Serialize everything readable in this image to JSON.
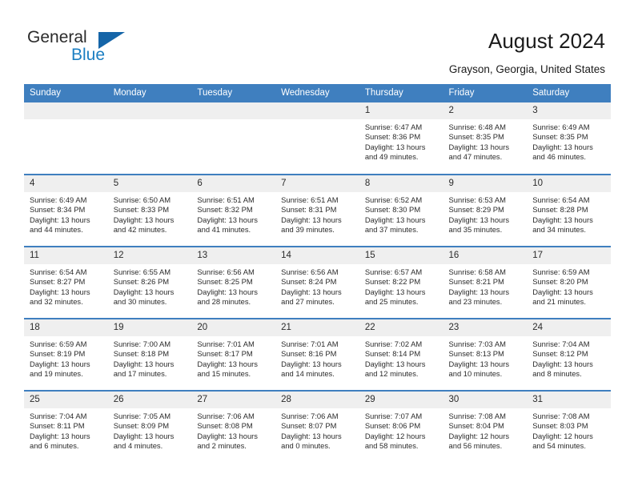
{
  "brand": {
    "name_top": "General",
    "name_bottom": "Blue",
    "triangle_color": "#1565a8",
    "blue_text_color": "#1b7ec2"
  },
  "header": {
    "title": "August 2024",
    "subtitle": "Grayson, Georgia, United States",
    "accent_color": "#3f7fbf",
    "daynum_band_color": "#efefef"
  },
  "calendar": {
    "weekday_headers": [
      "Sunday",
      "Monday",
      "Tuesday",
      "Wednesday",
      "Thursday",
      "Friday",
      "Saturday"
    ],
    "labels": {
      "sunrise": "Sunrise:",
      "sunset": "Sunset:",
      "daylight": "Daylight:"
    },
    "weeks": [
      [
        {
          "day": "",
          "empty": true
        },
        {
          "day": "",
          "empty": true
        },
        {
          "day": "",
          "empty": true
        },
        {
          "day": "",
          "empty": true
        },
        {
          "day": "1",
          "sunrise": "Sunrise: 6:47 AM",
          "sunset": "Sunset: 8:36 PM",
          "daylight": "Daylight: 13 hours and 49 minutes."
        },
        {
          "day": "2",
          "sunrise": "Sunrise: 6:48 AM",
          "sunset": "Sunset: 8:35 PM",
          "daylight": "Daylight: 13 hours and 47 minutes."
        },
        {
          "day": "3",
          "sunrise": "Sunrise: 6:49 AM",
          "sunset": "Sunset: 8:35 PM",
          "daylight": "Daylight: 13 hours and 46 minutes."
        }
      ],
      [
        {
          "day": "4",
          "sunrise": "Sunrise: 6:49 AM",
          "sunset": "Sunset: 8:34 PM",
          "daylight": "Daylight: 13 hours and 44 minutes."
        },
        {
          "day": "5",
          "sunrise": "Sunrise: 6:50 AM",
          "sunset": "Sunset: 8:33 PM",
          "daylight": "Daylight: 13 hours and 42 minutes."
        },
        {
          "day": "6",
          "sunrise": "Sunrise: 6:51 AM",
          "sunset": "Sunset: 8:32 PM",
          "daylight": "Daylight: 13 hours and 41 minutes."
        },
        {
          "day": "7",
          "sunrise": "Sunrise: 6:51 AM",
          "sunset": "Sunset: 8:31 PM",
          "daylight": "Daylight: 13 hours and 39 minutes."
        },
        {
          "day": "8",
          "sunrise": "Sunrise: 6:52 AM",
          "sunset": "Sunset: 8:30 PM",
          "daylight": "Daylight: 13 hours and 37 minutes."
        },
        {
          "day": "9",
          "sunrise": "Sunrise: 6:53 AM",
          "sunset": "Sunset: 8:29 PM",
          "daylight": "Daylight: 13 hours and 35 minutes."
        },
        {
          "day": "10",
          "sunrise": "Sunrise: 6:54 AM",
          "sunset": "Sunset: 8:28 PM",
          "daylight": "Daylight: 13 hours and 34 minutes."
        }
      ],
      [
        {
          "day": "11",
          "sunrise": "Sunrise: 6:54 AM",
          "sunset": "Sunset: 8:27 PM",
          "daylight": "Daylight: 13 hours and 32 minutes."
        },
        {
          "day": "12",
          "sunrise": "Sunrise: 6:55 AM",
          "sunset": "Sunset: 8:26 PM",
          "daylight": "Daylight: 13 hours and 30 minutes."
        },
        {
          "day": "13",
          "sunrise": "Sunrise: 6:56 AM",
          "sunset": "Sunset: 8:25 PM",
          "daylight": "Daylight: 13 hours and 28 minutes."
        },
        {
          "day": "14",
          "sunrise": "Sunrise: 6:56 AM",
          "sunset": "Sunset: 8:24 PM",
          "daylight": "Daylight: 13 hours and 27 minutes."
        },
        {
          "day": "15",
          "sunrise": "Sunrise: 6:57 AM",
          "sunset": "Sunset: 8:22 PM",
          "daylight": "Daylight: 13 hours and 25 minutes."
        },
        {
          "day": "16",
          "sunrise": "Sunrise: 6:58 AM",
          "sunset": "Sunset: 8:21 PM",
          "daylight": "Daylight: 13 hours and 23 minutes."
        },
        {
          "day": "17",
          "sunrise": "Sunrise: 6:59 AM",
          "sunset": "Sunset: 8:20 PM",
          "daylight": "Daylight: 13 hours and 21 minutes."
        }
      ],
      [
        {
          "day": "18",
          "sunrise": "Sunrise: 6:59 AM",
          "sunset": "Sunset: 8:19 PM",
          "daylight": "Daylight: 13 hours and 19 minutes."
        },
        {
          "day": "19",
          "sunrise": "Sunrise: 7:00 AM",
          "sunset": "Sunset: 8:18 PM",
          "daylight": "Daylight: 13 hours and 17 minutes."
        },
        {
          "day": "20",
          "sunrise": "Sunrise: 7:01 AM",
          "sunset": "Sunset: 8:17 PM",
          "daylight": "Daylight: 13 hours and 15 minutes."
        },
        {
          "day": "21",
          "sunrise": "Sunrise: 7:01 AM",
          "sunset": "Sunset: 8:16 PM",
          "daylight": "Daylight: 13 hours and 14 minutes."
        },
        {
          "day": "22",
          "sunrise": "Sunrise: 7:02 AM",
          "sunset": "Sunset: 8:14 PM",
          "daylight": "Daylight: 13 hours and 12 minutes."
        },
        {
          "day": "23",
          "sunrise": "Sunrise: 7:03 AM",
          "sunset": "Sunset: 8:13 PM",
          "daylight": "Daylight: 13 hours and 10 minutes."
        },
        {
          "day": "24",
          "sunrise": "Sunrise: 7:04 AM",
          "sunset": "Sunset: 8:12 PM",
          "daylight": "Daylight: 13 hours and 8 minutes."
        }
      ],
      [
        {
          "day": "25",
          "sunrise": "Sunrise: 7:04 AM",
          "sunset": "Sunset: 8:11 PM",
          "daylight": "Daylight: 13 hours and 6 minutes."
        },
        {
          "day": "26",
          "sunrise": "Sunrise: 7:05 AM",
          "sunset": "Sunset: 8:09 PM",
          "daylight": "Daylight: 13 hours and 4 minutes."
        },
        {
          "day": "27",
          "sunrise": "Sunrise: 7:06 AM",
          "sunset": "Sunset: 8:08 PM",
          "daylight": "Daylight: 13 hours and 2 minutes."
        },
        {
          "day": "28",
          "sunrise": "Sunrise: 7:06 AM",
          "sunset": "Sunset: 8:07 PM",
          "daylight": "Daylight: 13 hours and 0 minutes."
        },
        {
          "day": "29",
          "sunrise": "Sunrise: 7:07 AM",
          "sunset": "Sunset: 8:06 PM",
          "daylight": "Daylight: 12 hours and 58 minutes."
        },
        {
          "day": "30",
          "sunrise": "Sunrise: 7:08 AM",
          "sunset": "Sunset: 8:04 PM",
          "daylight": "Daylight: 12 hours and 56 minutes."
        },
        {
          "day": "31",
          "sunrise": "Sunrise: 7:08 AM",
          "sunset": "Sunset: 8:03 PM",
          "daylight": "Daylight: 12 hours and 54 minutes."
        }
      ]
    ]
  }
}
